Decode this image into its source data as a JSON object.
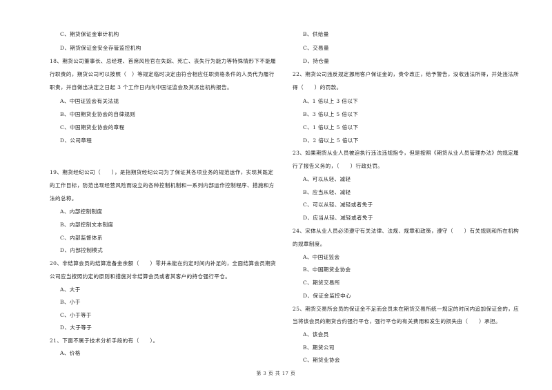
{
  "left_column": {
    "q17_tail": {
      "options": [
        {
          "label": "C、期货保证金审计机构"
        },
        {
          "label": "D、期货保证金安全存管监控机构"
        }
      ]
    },
    "q18": {
      "stem_lines": [
        "18、期货公司董事长、总经理、首席风险官在失踪、死亡、丧失行为能力等特殊情形下不能履",
        "行职责的，期货公司可以按照（　）等规定临时决定由符合相应任职资格条件的人员代为履行",
        "职责，并自做出决定之日起 3 个工作日内向中国证监会及其派出机构报告。"
      ],
      "options": [
        {
          "label": "A、中国证监会有关法规"
        },
        {
          "label": "B、中国期货业协会的自律规则"
        },
        {
          "label": "C、中国期货业协会的章程"
        },
        {
          "label": "D、公司章程"
        }
      ]
    },
    "q19": {
      "stem_lines": [
        "19、期货经纪公司（　　），是指期货经纪公司为了保证其各项业务的规范运作，实现其既定",
        "的工作目标，防范出现经营风险而设立的各种控制机制和一系列内部运作控制程序、措施和方",
        "法的总称。"
      ],
      "options": [
        {
          "label": "A、内部控制制度"
        },
        {
          "label": "B、内部控制文本制度"
        },
        {
          "label": "C、内部监督体系"
        },
        {
          "label": "D、内部控制模式"
        }
      ]
    },
    "q20": {
      "stem_lines": [
        "20、非结算会员的结算准备金余额（　　）零并未能在约定时间内补足的，全面结算会员期货",
        "公司应当按照约定的原则和措施对非结算会员或者其客户的持仓强行平仓。"
      ],
      "options": [
        {
          "label": "A、大于"
        },
        {
          "label": "B、小于"
        },
        {
          "label": "C、小于等于"
        },
        {
          "label": "D、大于等于"
        }
      ]
    },
    "q21": {
      "stem_lines": [
        "21、下面不属于技术分析手段的有（　　）。"
      ],
      "options": [
        {
          "label": "A、价格"
        }
      ]
    }
  },
  "right_column": {
    "q21_tail": {
      "options": [
        {
          "label": "B、供给量"
        },
        {
          "label": "C、交易量"
        },
        {
          "label": "D、持仓量"
        }
      ]
    },
    "q22": {
      "stem_lines": [
        "22、期货公司违反规定挪用客户保证金的，责令改正，给予警告，没收违法所得，并处违法所",
        "得（　　）的罚款。"
      ],
      "options": [
        {
          "label": "A、1 倍以上 3 倍以下"
        },
        {
          "label": "B、3 倍以上 5 倍以下"
        },
        {
          "label": "C、1 倍以上 5 倍以下"
        },
        {
          "label": "D、2 倍以上 5 倍以下"
        }
      ]
    },
    "q23": {
      "stem_lines": [
        "23、如果期货从业人员被迫执行违法违规指令，但是按照《期货从业人员管理办法》的规定履",
        "行了报告义务的，（　　）行政处罚。"
      ],
      "options": [
        {
          "label": "A、可以从轻、减轻"
        },
        {
          "label": "B、应当从轻、减轻"
        },
        {
          "label": "C、可以从轻、减轻或者免于"
        },
        {
          "label": "D、应当从轻、减轻或者免于"
        }
      ]
    },
    "q24": {
      "stem_lines": [
        "24、宋体从业人员必须遵守有关法律、法规、规章和政策，遵守（　　）有关规则和所在机构",
        "的规章制度。"
      ],
      "options": [
        {
          "label": "A、中国证监会"
        },
        {
          "label": "B、中国期货业协会"
        },
        {
          "label": "C、期货交易所"
        },
        {
          "label": "D、保证金监控中心"
        }
      ]
    },
    "q25": {
      "stem_lines": [
        "25、期货交易所会员的保证金不足而会员未在期货交易所统一规定的时间内追加保证金的，应",
        "当将该会员的期货合约强行平仓，强行平仓的有关费用和发生的损失由（　　）承担。"
      ],
      "options": [
        {
          "label": "A、该会员"
        },
        {
          "label": "B、期货公司"
        },
        {
          "label": "C、期货业协会"
        }
      ]
    }
  },
  "footer": {
    "page_label": "第 3 页 共 17 页"
  }
}
